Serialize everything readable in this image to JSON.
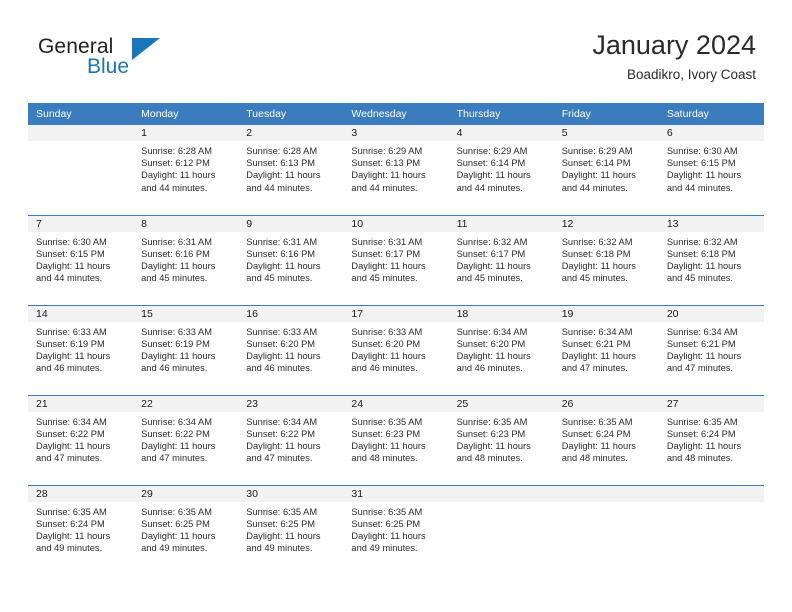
{
  "brand": {
    "word_one": "General",
    "word_two": "Blue",
    "triangle_icon": "triangle-icon",
    "accent_color": "#1b75bb"
  },
  "header": {
    "title": "January 2024",
    "subtitle": "Boadikro, Ivory Coast"
  },
  "calendar": {
    "header_bg": "#3a7cbe",
    "daynum_band_bg": "#f2f2f2",
    "weekday_headers": [
      "Sunday",
      "Monday",
      "Tuesday",
      "Wednesday",
      "Thursday",
      "Friday",
      "Saturday"
    ],
    "weeks": [
      [
        {
          "day": "",
          "sunrise": "",
          "sunset": "",
          "daylight_1": "",
          "daylight_2": ""
        },
        {
          "day": "1",
          "sunrise": "Sunrise: 6:28 AM",
          "sunset": "Sunset: 6:12 PM",
          "daylight_1": "Daylight: 11 hours",
          "daylight_2": "and 44 minutes."
        },
        {
          "day": "2",
          "sunrise": "Sunrise: 6:28 AM",
          "sunset": "Sunset: 6:13 PM",
          "daylight_1": "Daylight: 11 hours",
          "daylight_2": "and 44 minutes."
        },
        {
          "day": "3",
          "sunrise": "Sunrise: 6:29 AM",
          "sunset": "Sunset: 6:13 PM",
          "daylight_1": "Daylight: 11 hours",
          "daylight_2": "and 44 minutes."
        },
        {
          "day": "4",
          "sunrise": "Sunrise: 6:29 AM",
          "sunset": "Sunset: 6:14 PM",
          "daylight_1": "Daylight: 11 hours",
          "daylight_2": "and 44 minutes."
        },
        {
          "day": "5",
          "sunrise": "Sunrise: 6:29 AM",
          "sunset": "Sunset: 6:14 PM",
          "daylight_1": "Daylight: 11 hours",
          "daylight_2": "and 44 minutes."
        },
        {
          "day": "6",
          "sunrise": "Sunrise: 6:30 AM",
          "sunset": "Sunset: 6:15 PM",
          "daylight_1": "Daylight: 11 hours",
          "daylight_2": "and 44 minutes."
        }
      ],
      [
        {
          "day": "7",
          "sunrise": "Sunrise: 6:30 AM",
          "sunset": "Sunset: 6:15 PM",
          "daylight_1": "Daylight: 11 hours",
          "daylight_2": "and 44 minutes."
        },
        {
          "day": "8",
          "sunrise": "Sunrise: 6:31 AM",
          "sunset": "Sunset: 6:16 PM",
          "daylight_1": "Daylight: 11 hours",
          "daylight_2": "and 45 minutes."
        },
        {
          "day": "9",
          "sunrise": "Sunrise: 6:31 AM",
          "sunset": "Sunset: 6:16 PM",
          "daylight_1": "Daylight: 11 hours",
          "daylight_2": "and 45 minutes."
        },
        {
          "day": "10",
          "sunrise": "Sunrise: 6:31 AM",
          "sunset": "Sunset: 6:17 PM",
          "daylight_1": "Daylight: 11 hours",
          "daylight_2": "and 45 minutes."
        },
        {
          "day": "11",
          "sunrise": "Sunrise: 6:32 AM",
          "sunset": "Sunset: 6:17 PM",
          "daylight_1": "Daylight: 11 hours",
          "daylight_2": "and 45 minutes."
        },
        {
          "day": "12",
          "sunrise": "Sunrise: 6:32 AM",
          "sunset": "Sunset: 6:18 PM",
          "daylight_1": "Daylight: 11 hours",
          "daylight_2": "and 45 minutes."
        },
        {
          "day": "13",
          "sunrise": "Sunrise: 6:32 AM",
          "sunset": "Sunset: 6:18 PM",
          "daylight_1": "Daylight: 11 hours",
          "daylight_2": "and 45 minutes."
        }
      ],
      [
        {
          "day": "14",
          "sunrise": "Sunrise: 6:33 AM",
          "sunset": "Sunset: 6:19 PM",
          "daylight_1": "Daylight: 11 hours",
          "daylight_2": "and 46 minutes."
        },
        {
          "day": "15",
          "sunrise": "Sunrise: 6:33 AM",
          "sunset": "Sunset: 6:19 PM",
          "daylight_1": "Daylight: 11 hours",
          "daylight_2": "and 46 minutes."
        },
        {
          "day": "16",
          "sunrise": "Sunrise: 6:33 AM",
          "sunset": "Sunset: 6:20 PM",
          "daylight_1": "Daylight: 11 hours",
          "daylight_2": "and 46 minutes."
        },
        {
          "day": "17",
          "sunrise": "Sunrise: 6:33 AM",
          "sunset": "Sunset: 6:20 PM",
          "daylight_1": "Daylight: 11 hours",
          "daylight_2": "and 46 minutes."
        },
        {
          "day": "18",
          "sunrise": "Sunrise: 6:34 AM",
          "sunset": "Sunset: 6:20 PM",
          "daylight_1": "Daylight: 11 hours",
          "daylight_2": "and 46 minutes."
        },
        {
          "day": "19",
          "sunrise": "Sunrise: 6:34 AM",
          "sunset": "Sunset: 6:21 PM",
          "daylight_1": "Daylight: 11 hours",
          "daylight_2": "and 47 minutes."
        },
        {
          "day": "20",
          "sunrise": "Sunrise: 6:34 AM",
          "sunset": "Sunset: 6:21 PM",
          "daylight_1": "Daylight: 11 hours",
          "daylight_2": "and 47 minutes."
        }
      ],
      [
        {
          "day": "21",
          "sunrise": "Sunrise: 6:34 AM",
          "sunset": "Sunset: 6:22 PM",
          "daylight_1": "Daylight: 11 hours",
          "daylight_2": "and 47 minutes."
        },
        {
          "day": "22",
          "sunrise": "Sunrise: 6:34 AM",
          "sunset": "Sunset: 6:22 PM",
          "daylight_1": "Daylight: 11 hours",
          "daylight_2": "and 47 minutes."
        },
        {
          "day": "23",
          "sunrise": "Sunrise: 6:34 AM",
          "sunset": "Sunset: 6:22 PM",
          "daylight_1": "Daylight: 11 hours",
          "daylight_2": "and 47 minutes."
        },
        {
          "day": "24",
          "sunrise": "Sunrise: 6:35 AM",
          "sunset": "Sunset: 6:23 PM",
          "daylight_1": "Daylight: 11 hours",
          "daylight_2": "and 48 minutes."
        },
        {
          "day": "25",
          "sunrise": "Sunrise: 6:35 AM",
          "sunset": "Sunset: 6:23 PM",
          "daylight_1": "Daylight: 11 hours",
          "daylight_2": "and 48 minutes."
        },
        {
          "day": "26",
          "sunrise": "Sunrise: 6:35 AM",
          "sunset": "Sunset: 6:24 PM",
          "daylight_1": "Daylight: 11 hours",
          "daylight_2": "and 48 minutes."
        },
        {
          "day": "27",
          "sunrise": "Sunrise: 6:35 AM",
          "sunset": "Sunset: 6:24 PM",
          "daylight_1": "Daylight: 11 hours",
          "daylight_2": "and 48 minutes."
        }
      ],
      [
        {
          "day": "28",
          "sunrise": "Sunrise: 6:35 AM",
          "sunset": "Sunset: 6:24 PM",
          "daylight_1": "Daylight: 11 hours",
          "daylight_2": "and 49 minutes."
        },
        {
          "day": "29",
          "sunrise": "Sunrise: 6:35 AM",
          "sunset": "Sunset: 6:25 PM",
          "daylight_1": "Daylight: 11 hours",
          "daylight_2": "and 49 minutes."
        },
        {
          "day": "30",
          "sunrise": "Sunrise: 6:35 AM",
          "sunset": "Sunset: 6:25 PM",
          "daylight_1": "Daylight: 11 hours",
          "daylight_2": "and 49 minutes."
        },
        {
          "day": "31",
          "sunrise": "Sunrise: 6:35 AM",
          "sunset": "Sunset: 6:25 PM",
          "daylight_1": "Daylight: 11 hours",
          "daylight_2": "and 49 minutes."
        },
        {
          "day": "",
          "sunrise": "",
          "sunset": "",
          "daylight_1": "",
          "daylight_2": ""
        },
        {
          "day": "",
          "sunrise": "",
          "sunset": "",
          "daylight_1": "",
          "daylight_2": ""
        },
        {
          "day": "",
          "sunrise": "",
          "sunset": "",
          "daylight_1": "",
          "daylight_2": ""
        }
      ]
    ]
  }
}
